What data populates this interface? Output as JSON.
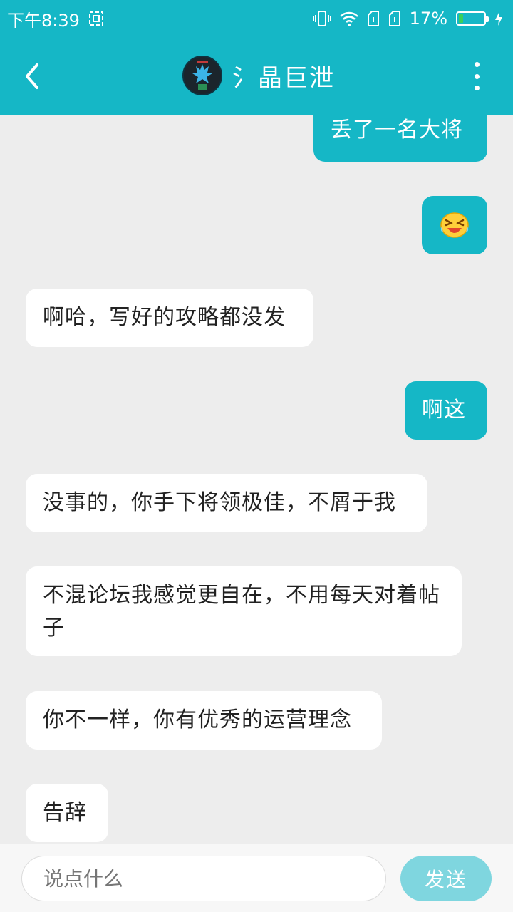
{
  "status_bar": {
    "time": "下午8:39",
    "battery_percent": "17%",
    "battery_level": 0.17,
    "icons": [
      "screenshot-icon",
      "vibrate-icon",
      "wifi-icon",
      "sim1-icon",
      "sim2-icon",
      "battery-icon",
      "charging-icon"
    ]
  },
  "header": {
    "title": "氵晶巨泄",
    "back_icon": "chevron-left-icon",
    "more_icon": "more-vertical-icon"
  },
  "messages": [
    {
      "side": "out",
      "text": "丢了一名大将"
    },
    {
      "side": "out",
      "emoji": "laughing-tears-emoji"
    },
    {
      "side": "in",
      "text": "啊哈，写好的攻略都没发"
    },
    {
      "side": "out",
      "text": "啊这"
    },
    {
      "side": "in",
      "text": "没事的，你手下将领极佳，不屑于我"
    },
    {
      "side": "in",
      "text": "不混论坛我感觉更自在，不用每天对着帖子"
    },
    {
      "side": "in",
      "text": "你不一样，你有优秀的运营理念"
    },
    {
      "side": "in",
      "text": "告辞"
    }
  ],
  "composer": {
    "placeholder": "说点什么",
    "send_label": "发送"
  },
  "colors": {
    "accent": "#15b7c6",
    "send_disabled": "#7fd6df",
    "background": "#ededed"
  }
}
